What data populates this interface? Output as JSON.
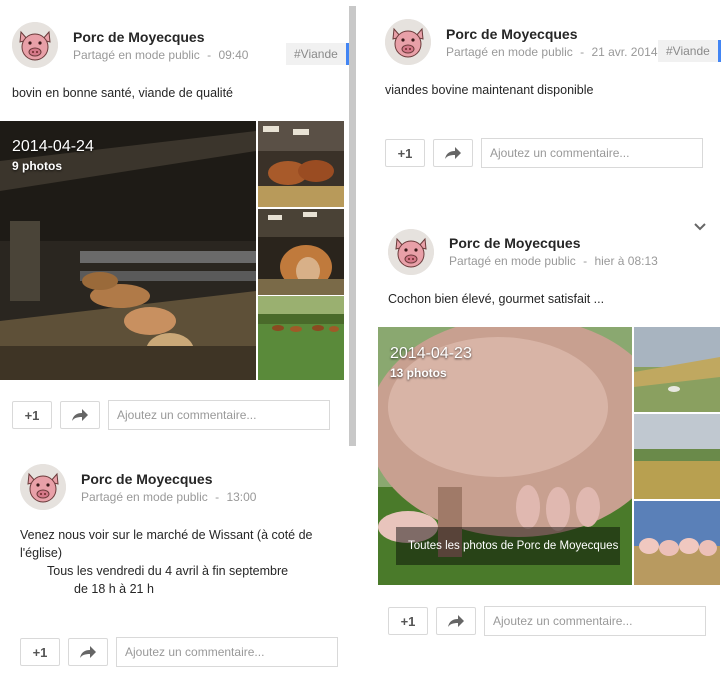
{
  "posts": [
    {
      "author": "Porc de Moyecques",
      "visibility": "Partagé en mode public",
      "separator": "-",
      "time": "09:40",
      "tag": "#Viande",
      "text": "bovin en bonne santé, viande de qualité",
      "album": {
        "date": "2014-04-24",
        "count": "9 photos"
      },
      "plus_one": "+1",
      "comment_placeholder": "Ajoutez un commentaire..."
    },
    {
      "author": "Porc de Moyecques",
      "visibility": "Partagé en mode public",
      "separator": "-",
      "time": "13:00",
      "text_lines": [
        "Venez nous voir sur le marché de Wissant (à coté de",
        "l'église)",
        "Tous les vendredi du 4 avril à fin septembre",
        "de 18 h à 21 h"
      ],
      "plus_one": "+1",
      "comment_placeholder": "Ajoutez un commentaire..."
    },
    {
      "author": "Porc de Moyecques",
      "visibility": "Partagé en mode public",
      "separator": "-",
      "time": "21 avr. 2014",
      "tag": "#Viande",
      "text": "viandes bovine maintenant disponible",
      "plus_one": "+1",
      "comment_placeholder": "Ajoutez un commentaire..."
    },
    {
      "author": "Porc de Moyecques",
      "visibility": "Partagé en mode public",
      "separator": "-",
      "time": "hier à 08:13",
      "text": "Cochon bien élevé, gourmet satisfait ...",
      "album": {
        "date": "2014-04-23",
        "count": "13 photos",
        "all_photos_link": "Toutes les photos de Porc de Moyecques"
      },
      "plus_one": "+1",
      "comment_placeholder": "Ajoutez un commentaire..."
    }
  ],
  "colors": {
    "tag_accent": "#4285f4",
    "avatar_pink": "#e8a0a8"
  },
  "icons": {
    "share": "share-arrow-icon",
    "avatar": "pig-avatar-icon",
    "expand": "chevron-down-icon"
  }
}
